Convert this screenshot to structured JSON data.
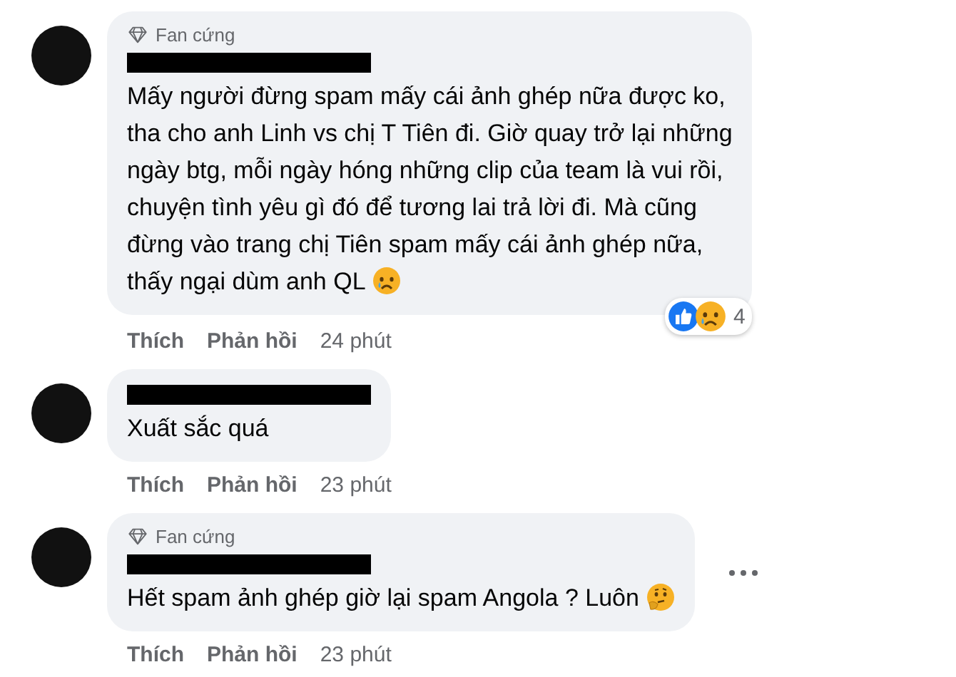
{
  "comments": [
    {
      "badge": "Fan cứng",
      "name_redacted": true,
      "text": "Mấy người đừng spam mấy cái ảnh ghép nữa được ko,\ntha cho anh Linh vs chị T Tiên đi. Giờ quay trở lại những\nngày btg, mỗi ngày hóng những clip của team là vui rồi,\nchuyện tình yêu gì đó để tương lai trả lời đi. Mà cũng\nđừng vào trang chị Tiên spam mấy cái ảnh ghép nữa,\nthấy ngại dùm anh QL",
      "emoji": {
        "kind": "crying"
      },
      "reactions": {
        "items": [
          {
            "kind": "like"
          },
          {
            "kind": "crying"
          }
        ],
        "count": "4"
      },
      "menu_visible": false,
      "actions": [
        "Thích",
        "Phản hồi"
      ],
      "time": "24 phút"
    },
    {
      "name_redacted": true,
      "text": "Xuất sắc quá",
      "menu_visible": false,
      "actions": [
        "Thích",
        "Phản hồi"
      ],
      "time": "23 phút"
    },
    {
      "badge": "Fan cứng",
      "name_redacted": true,
      "text": "Hết spam ảnh ghép giờ lại spam Angola ? Luôn",
      "emoji": {
        "kind": "thinking"
      },
      "menu_visible": true,
      "actions": [
        "Thích",
        "Phản hồi"
      ],
      "time": "23 phút"
    }
  ]
}
